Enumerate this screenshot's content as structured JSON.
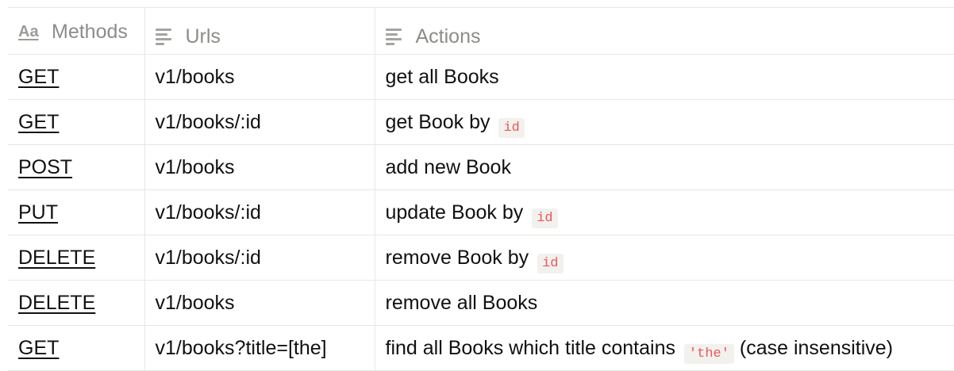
{
  "table": {
    "headers": {
      "methods": "Methods",
      "urls": "Urls",
      "actions": "Actions"
    },
    "header_icons": {
      "methods": "text-property-icon",
      "urls": "text-lines-icon",
      "actions": "text-lines-icon"
    },
    "rows": [
      {
        "method": "GET",
        "url": "v1/books",
        "action": "get all Books",
        "code": "",
        "action_suffix": ""
      },
      {
        "method": "GET",
        "url": "v1/books/:id",
        "action": "get Book by",
        "code": "id",
        "action_suffix": ""
      },
      {
        "method": "POST",
        "url": "v1/books",
        "action": "add new Book",
        "code": "",
        "action_suffix": ""
      },
      {
        "method": "PUT",
        "url": "v1/books/:id",
        "action": "update Book by",
        "code": "id",
        "action_suffix": ""
      },
      {
        "method": "DELETE",
        "url": "v1/books/:id",
        "action": "remove Book by",
        "code": "id",
        "action_suffix": ""
      },
      {
        "method": "DELETE",
        "url": "v1/books",
        "action": "remove all Books",
        "code": "",
        "action_suffix": ""
      },
      {
        "method": "GET",
        "url": "v1/books?title=[the]",
        "action": "find all Books which title contains",
        "code": "'the'",
        "action_suffix": "(case insensitive)"
      }
    ]
  },
  "colors": {
    "header_text": "#8e8c88",
    "border": "#e7e7e5",
    "code_text": "#eb5757",
    "code_bg": "#f2f1ee",
    "text": "#111111"
  }
}
